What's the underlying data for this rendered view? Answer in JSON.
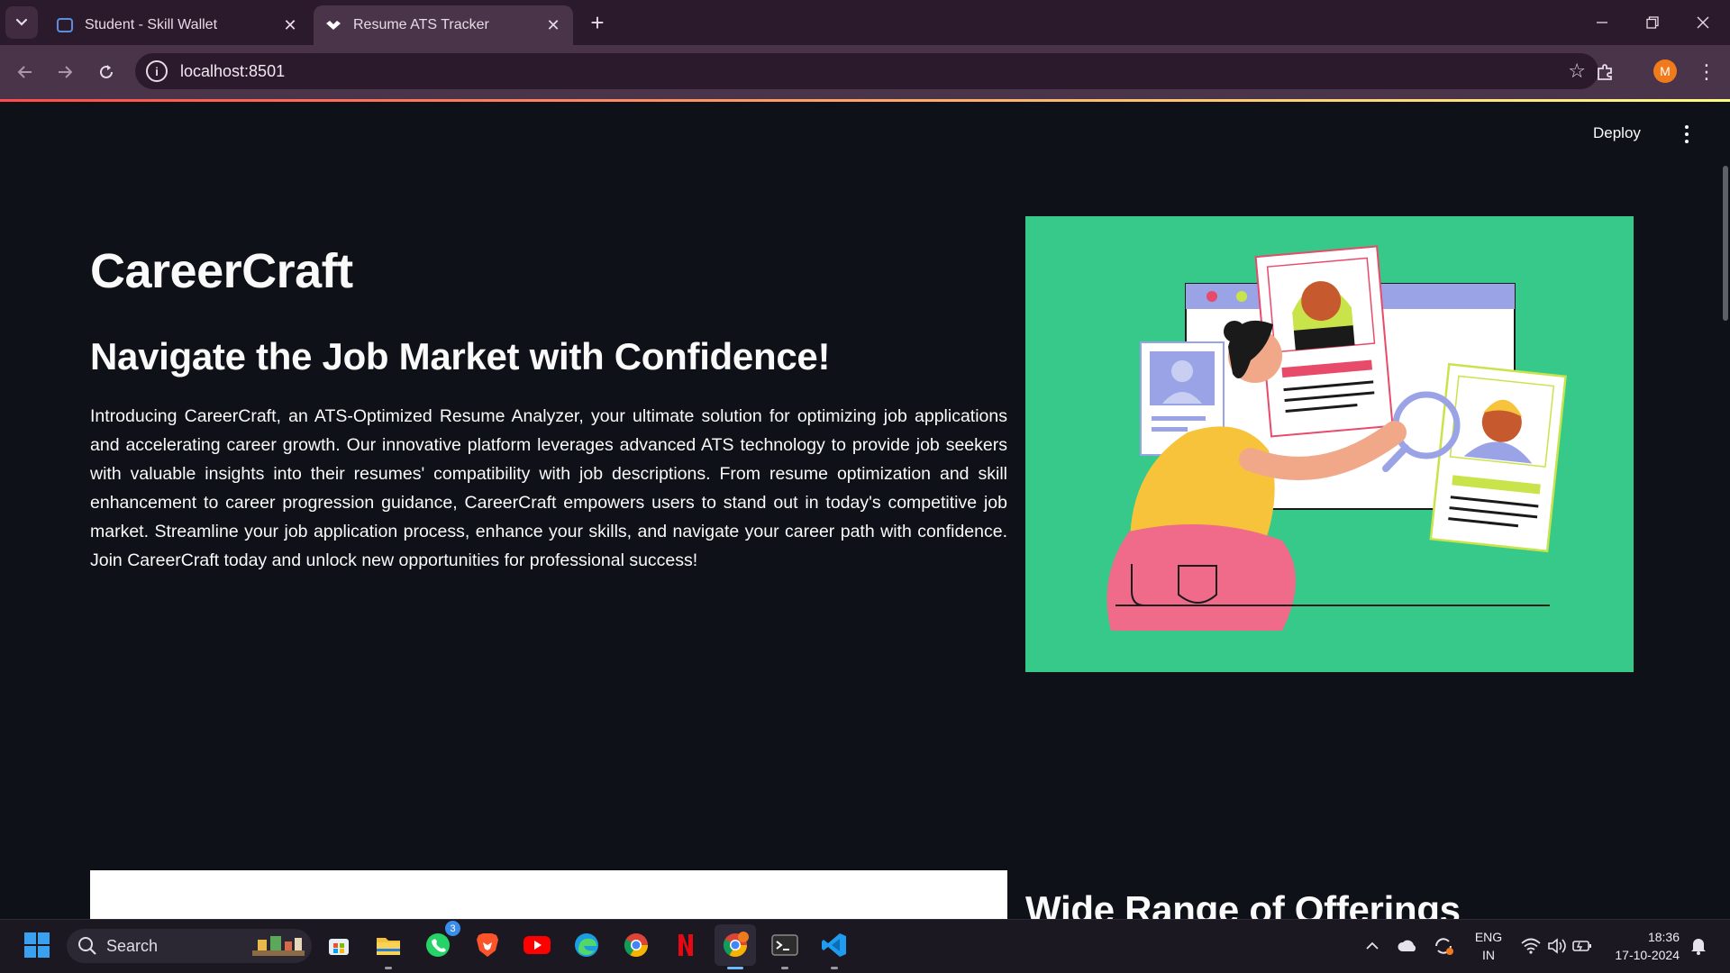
{
  "browser": {
    "tabs": [
      {
        "title": "Student - Skill Wallet",
        "active": false
      },
      {
        "title": "Resume ATS Tracker",
        "active": true
      }
    ],
    "url": "localhost:8501",
    "profile_initial": "M"
  },
  "app": {
    "deploy_label": "Deploy",
    "title": "CareerCraft",
    "subtitle": "Navigate the Job Market with Confidence!",
    "description": "Introducing CareerCraft, an ATS-Optimized Resume Analyzer, your ultimate solution for optimizing job applications and accelerating career growth. Our innovative platform leverages advanced ATS technology to provide job seekers with valuable insights into their resumes' compatibility with job descriptions. From resume optimization and skill enhancement to career progression guidance, CareerCraft empowers users to stand out in today's competitive job market. Streamline your job application process, enhance your skills, and navigate your career path with confidence. Join CareerCraft today and unlock new opportunities for professional success!",
    "offerings_heading": "Wide Range of Offerings",
    "hero_bg": "#36c98a",
    "accent_gradient": [
      "#ff4b4b",
      "#fffd80"
    ]
  },
  "taskbar": {
    "search_label": "Search",
    "whatsapp_badge": "3",
    "language": "ENG",
    "region": "IN",
    "time": "18:36",
    "date": "17-10-2024",
    "pinned": [
      "start-icon",
      "widgets-icon",
      "store-icon",
      "file-explorer-icon",
      "whatsapp-icon",
      "brave-icon",
      "youtube-icon",
      "edge-icon",
      "chrome-icon",
      "netflix-icon",
      "chrome-profile-icon",
      "terminal-icon",
      "vscode-icon"
    ]
  }
}
